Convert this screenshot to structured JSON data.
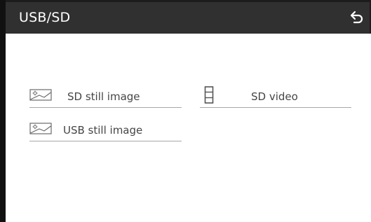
{
  "header": {
    "title": "USB/SD",
    "back_icon": "return-arrow-icon"
  },
  "menu": {
    "items": [
      {
        "label": "SD still image",
        "icon": "still-image-icon"
      },
      {
        "label": "SD video",
        "icon": "film-strip-icon"
      },
      {
        "label": "USB still image",
        "icon": "still-image-icon"
      }
    ]
  },
  "colors": {
    "titlebar": "#303030",
    "title_text": "#ffffff",
    "item_text": "#454545",
    "divider": "#a8a8a8",
    "frame_edge": "#111111"
  }
}
